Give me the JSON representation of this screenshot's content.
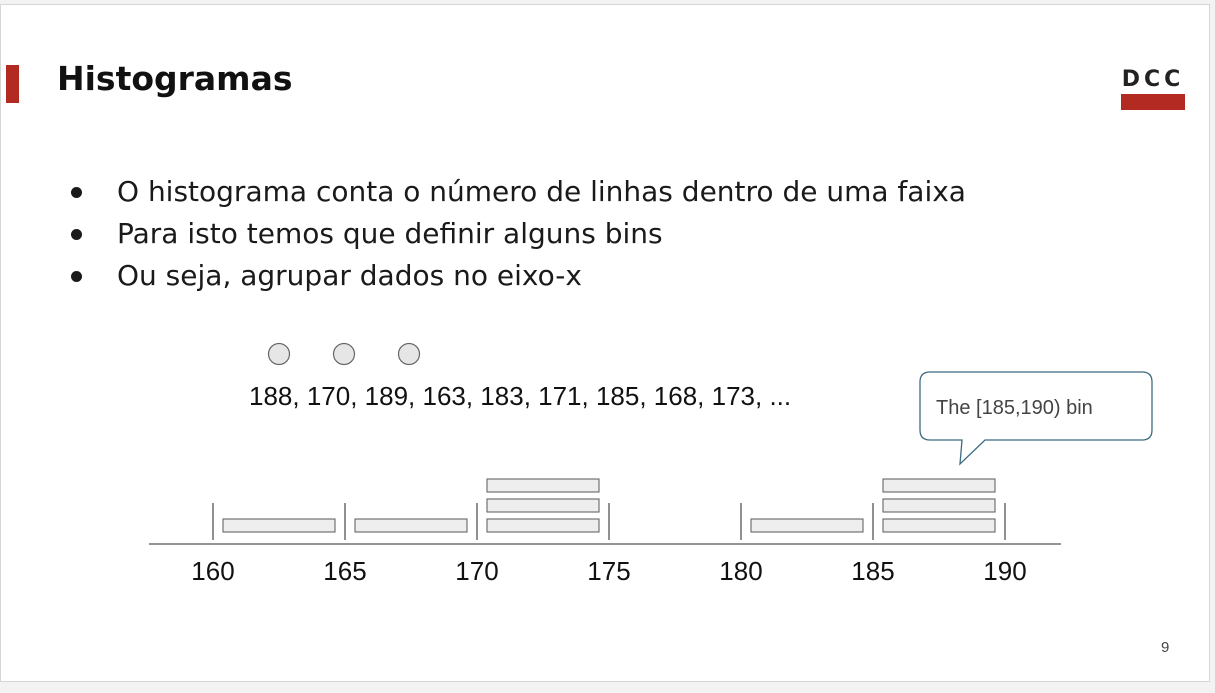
{
  "slide": {
    "title": "Histogramas",
    "logo_text": "DCC",
    "page_number": "9",
    "accent_color": "#b22a22"
  },
  "bullets": [
    "O histograma conta o número de linhas dentro de uma faixa",
    "Para isto temos que definir alguns bins",
    "Ou seja, agrupar dados no eixo-x"
  ],
  "illustration": {
    "data_sequence": "188, 170, 189, 163, 183, 171, 185, 168, 173, ...",
    "pointer_circles": 3,
    "callout": "The [185,190) bin",
    "axis_ticks": [
      "160",
      "165",
      "170",
      "175",
      "180",
      "185",
      "190"
    ],
    "bins": [
      {
        "start": 160,
        "end": 165,
        "count": 1
      },
      {
        "start": 165,
        "end": 170,
        "count": 1
      },
      {
        "start": 170,
        "end": 175,
        "count": 3
      },
      {
        "start": 175,
        "end": 180,
        "count": 0
      },
      {
        "start": 180,
        "end": 185,
        "count": 1
      },
      {
        "start": 185,
        "end": 190,
        "count": 3
      }
    ]
  }
}
